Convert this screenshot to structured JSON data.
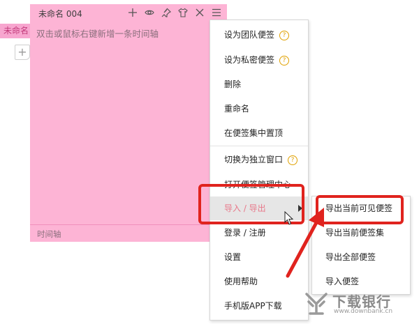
{
  "side": {
    "tab_label": "未命名",
    "add_icon": "plus-icon"
  },
  "note": {
    "title": "未命名 004",
    "placeholder": "双击或鼠标右键新增一条时间轴",
    "footer_label": "时间轴",
    "background": "#fdb4d5",
    "tools": [
      "plus-icon",
      "eye-icon",
      "pin-icon",
      "shirt-icon",
      "close-icon",
      "menu-icon"
    ]
  },
  "menu": {
    "items": [
      {
        "label": "设为团队便签",
        "help": true
      },
      {
        "label": "设为私密便签",
        "help": true
      },
      {
        "label": "删除",
        "help": false
      },
      {
        "label": "重命名",
        "help": false
      },
      {
        "label": "在便签集中置顶",
        "help": false
      },
      {
        "label": "切换为独立窗口",
        "help": true
      },
      {
        "label": "打开便签管理中心",
        "help": false
      },
      {
        "label": "导入 / 导出",
        "help": false,
        "submenu": true
      },
      {
        "label": "登录 / 注册",
        "help": false
      },
      {
        "label": "设置",
        "help": false
      },
      {
        "label": "使用帮助",
        "help": false
      },
      {
        "label": "手机版APP下载",
        "help": false
      }
    ],
    "help_glyph": "?"
  },
  "submenu": {
    "items": [
      {
        "label": "导出当前可见便签"
      },
      {
        "label": "导出当前便签集"
      },
      {
        "label": "导出全部便签"
      },
      {
        "label": "导入便签"
      }
    ]
  },
  "annotation": {
    "color": "#e0231e"
  },
  "watermark": {
    "title": "下载银行",
    "subtitle": "www.downbank.cn"
  }
}
